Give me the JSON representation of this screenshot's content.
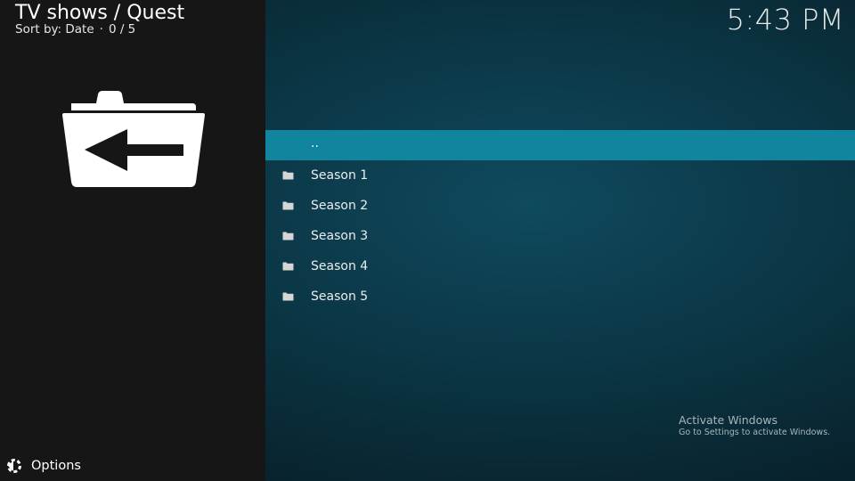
{
  "header": {
    "title": "TV shows / Quest",
    "sort_label": "Sort by: Date",
    "separator": "·",
    "count": "0 / 5"
  },
  "clock": "5:43 PM",
  "thumbnail": {
    "icon": "folder-back-icon"
  },
  "list": {
    "parent": "..",
    "items": [
      {
        "label": "Season 1",
        "icon": "folder-icon"
      },
      {
        "label": "Season 2",
        "icon": "folder-icon"
      },
      {
        "label": "Season 3",
        "icon": "folder-icon"
      },
      {
        "label": "Season 4",
        "icon": "folder-icon"
      },
      {
        "label": "Season 5",
        "icon": "folder-icon"
      }
    ]
  },
  "options": {
    "label": "Options",
    "icon": "options-icon"
  },
  "watermark": {
    "title": "Activate Windows",
    "subtitle": "Go to Settings to activate Windows."
  },
  "colors": {
    "focus_bar": "#12859e",
    "left_panel": "#161616",
    "background": "#0b3746"
  }
}
